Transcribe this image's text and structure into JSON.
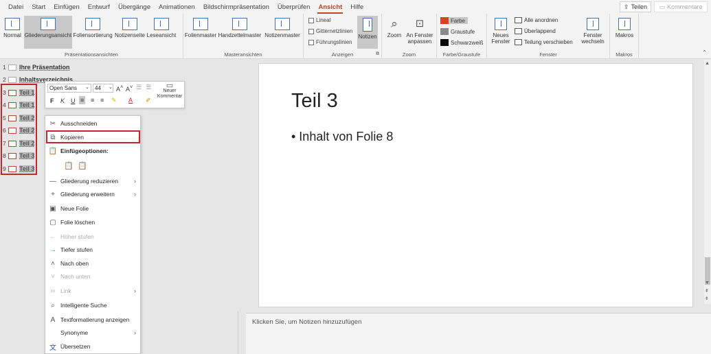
{
  "tabs": [
    {
      "label": "Datei"
    },
    {
      "label": "Start"
    },
    {
      "label": "Einfügen"
    },
    {
      "label": "Entwurf"
    },
    {
      "label": "Übergänge"
    },
    {
      "label": "Animationen"
    },
    {
      "label": "Bildschirmpräsentation"
    },
    {
      "label": "Überprüfen"
    },
    {
      "label": "Ansicht",
      "active": true
    },
    {
      "label": "Hilfe"
    }
  ],
  "share_label": "Teilen",
  "comments_label": "Kommentare",
  "ribbon": {
    "presentation_views": {
      "label": "Präsentationsansichten",
      "buttons": [
        "Normal",
        "Gliederungsansicht",
        "Foliensortierung",
        "Notizenseite",
        "Leseansicht"
      ]
    },
    "master_views": {
      "label": "Masteransichten",
      "buttons": [
        "Folienmaster",
        "Handzettelmaster",
        "Notizenmaster"
      ]
    },
    "show": {
      "label": "Anzeigen",
      "checks": [
        "Lineal",
        "Gitternetzlinien",
        "Führungslinien"
      ],
      "notes": "Notizen"
    },
    "zoom": {
      "label": "Zoom",
      "zoom": "Zoom",
      "fit": "An Fenster anpassen"
    },
    "color": {
      "label": "Farbe/Graustufe",
      "options": [
        "Farbe",
        "Graustufe",
        "Schwarzweiß"
      ],
      "colors": [
        "#d24726",
        "#8a8a8a",
        "#000000"
      ]
    },
    "window": {
      "label": "Fenster",
      "new_window": "Neues Fenster",
      "items": [
        "Alle anordnen",
        "Überlappend",
        "Teilung verschieben"
      ],
      "switch": "Fenster wechseln"
    },
    "macros": {
      "label": "Makros",
      "button": "Makros"
    }
  },
  "outline": {
    "rows": [
      {
        "num": "1",
        "text": "Ihre Präsentation"
      },
      {
        "num": "2",
        "text": "Inhaltsverzeichnis"
      },
      {
        "num": "3",
        "text": "Teil 1"
      },
      {
        "num": "4",
        "text": "Teil 1"
      },
      {
        "num": "5",
        "text": "Teil 2"
      },
      {
        "num": "6",
        "text": "Teil 2"
      },
      {
        "num": "7",
        "text": "Teil 2"
      },
      {
        "num": "8",
        "text": "Teil 3"
      },
      {
        "num": "9",
        "text": "Teil 3"
      }
    ]
  },
  "mini_toolbar": {
    "font": "Open Sans",
    "size": "44",
    "new_comment": "Neuer Kommentar"
  },
  "context_menu": {
    "items": [
      {
        "label": "Ausschneiden",
        "icon": "scissors-icon"
      },
      {
        "label": "Kopieren",
        "icon": "copy-icon"
      },
      {
        "label": "Einfügeoptionen:",
        "icon": "paste-icon"
      },
      {
        "label": "Gliederung reduzieren",
        "icon": "minus-icon"
      },
      {
        "label": "Gliederung erweitern",
        "icon": "plus-icon"
      },
      {
        "label": "Neue Folie",
        "icon": "new-slide-icon"
      },
      {
        "label": "Folie löschen",
        "icon": "delete-slide-icon"
      },
      {
        "label": "Höher stufen",
        "icon": "arrow-left-icon"
      },
      {
        "label": "Tiefer stufen",
        "icon": "arrow-right-icon"
      },
      {
        "label": "Nach oben",
        "icon": "chevron-up-icon"
      },
      {
        "label": "Nach unten",
        "icon": "chevron-down-icon"
      },
      {
        "label": "Link",
        "icon": "link-icon"
      },
      {
        "label": "Intelligente Suche",
        "icon": "search-icon"
      },
      {
        "label": "Textformatierung anzeigen",
        "icon": "text-format-icon"
      },
      {
        "label": "Synonyme",
        "icon": "synonyms-icon"
      },
      {
        "label": "Übersetzen",
        "icon": "translate-icon"
      }
    ]
  },
  "slide": {
    "title": "Teil 3",
    "bullet": "• Inhalt von Folie 8"
  },
  "notes_placeholder": "Klicken Sie, um Notizen hinzuzufügen"
}
